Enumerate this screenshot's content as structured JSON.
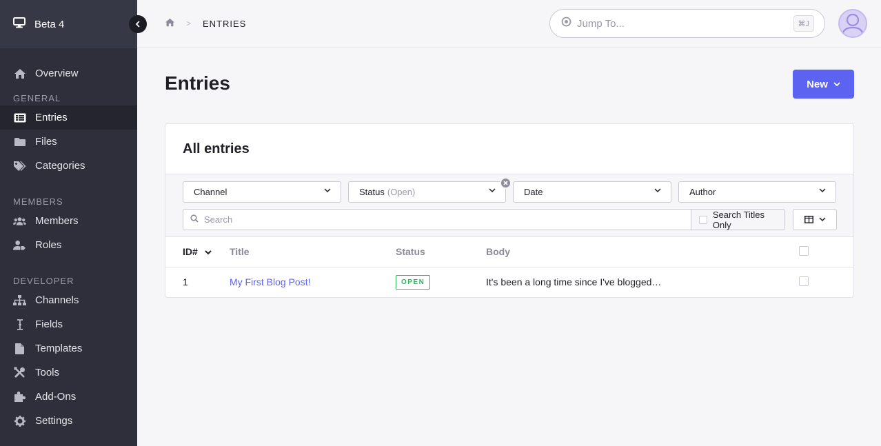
{
  "site": {
    "name": "Beta 4"
  },
  "sidebar": {
    "overview": "Overview",
    "sections": {
      "general": "GENERAL",
      "members": "MEMBERS",
      "developer": "DEVELOPER"
    },
    "general_items": [
      {
        "label": "Entries",
        "icon": "entries-icon",
        "active": true
      },
      {
        "label": "Files",
        "icon": "folder-icon"
      },
      {
        "label": "Categories",
        "icon": "tags-icon"
      }
    ],
    "members_items": [
      {
        "label": "Members",
        "icon": "users-icon"
      },
      {
        "label": "Roles",
        "icon": "user-tag-icon"
      }
    ],
    "developer_items": [
      {
        "label": "Channels",
        "icon": "sitemap-icon"
      },
      {
        "label": "Fields",
        "icon": "i-cursor-icon"
      },
      {
        "label": "Templates",
        "icon": "file-icon"
      },
      {
        "label": "Tools",
        "icon": "tools-icon"
      },
      {
        "label": "Add-Ons",
        "icon": "puzzle-icon"
      },
      {
        "label": "Settings",
        "icon": "gear-icon"
      }
    ]
  },
  "header": {
    "breadcrumb": "ENTRIES",
    "jump_placeholder": "Jump To...",
    "jump_shortcut": "⌘J"
  },
  "page": {
    "title": "Entries",
    "new_button": "New"
  },
  "panel": {
    "title": "All entries",
    "filters": {
      "channel": "Channel",
      "status": "Status",
      "status_value": "(Open)",
      "date": "Date",
      "author": "Author"
    },
    "search_placeholder": "Search",
    "titles_only": "Search Titles Only",
    "columns": {
      "id": "ID#",
      "title": "Title",
      "status": "Status",
      "body": "Body"
    },
    "rows": [
      {
        "id": "1",
        "title": "My First Blog Post!",
        "status": "OPEN",
        "body": "It's been a long time since I've blogged…"
      }
    ]
  },
  "colors": {
    "accent": "#5d63f1",
    "sidebar": "#2e2f3a",
    "status_open": "#2db45a"
  }
}
